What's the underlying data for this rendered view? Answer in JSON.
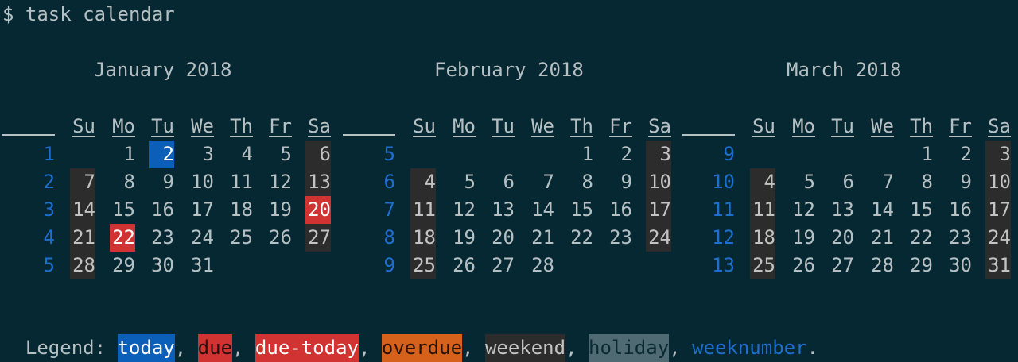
{
  "terminal": {
    "prompt": "$ task calendar"
  },
  "calendar": {
    "day_headers": [
      "Su",
      "Mo",
      "Tu",
      "We",
      "Th",
      "Fr",
      "Sa"
    ],
    "months": [
      {
        "title": "January 2018",
        "weeks": [
          {
            "num": "1",
            "days": [
              "",
              "1",
              "2",
              "3",
              "4",
              "5",
              "6"
            ]
          },
          {
            "num": "2",
            "days": [
              "7",
              "8",
              "9",
              "10",
              "11",
              "12",
              "13"
            ]
          },
          {
            "num": "3",
            "days": [
              "14",
              "15",
              "16",
              "17",
              "18",
              "19",
              "20"
            ]
          },
          {
            "num": "4",
            "days": [
              "21",
              "22",
              "23",
              "24",
              "25",
              "26",
              "27"
            ]
          },
          {
            "num": "5",
            "days": [
              "28",
              "29",
              "30",
              "31",
              "",
              "",
              ""
            ]
          }
        ],
        "today": "2",
        "due": [
          "22"
        ],
        "due_today_or_highlight": [
          "20"
        ]
      },
      {
        "title": "February 2018",
        "weeks": [
          {
            "num": "5",
            "days": [
              "",
              "",
              "",
              "",
              "1",
              "2",
              "3"
            ]
          },
          {
            "num": "6",
            "days": [
              "4",
              "5",
              "6",
              "7",
              "8",
              "9",
              "10"
            ]
          },
          {
            "num": "7",
            "days": [
              "11",
              "12",
              "13",
              "14",
              "15",
              "16",
              "17"
            ]
          },
          {
            "num": "8",
            "days": [
              "18",
              "19",
              "20",
              "21",
              "22",
              "23",
              "24"
            ]
          },
          {
            "num": "9",
            "days": [
              "25",
              "26",
              "27",
              "28",
              "",
              "",
              ""
            ]
          }
        ]
      },
      {
        "title": "March 2018",
        "weeks": [
          {
            "num": "9",
            "days": [
              "",
              "",
              "",
              "",
              "1",
              "2",
              "3"
            ]
          },
          {
            "num": "10",
            "days": [
              "4",
              "5",
              "6",
              "7",
              "8",
              "9",
              "10"
            ]
          },
          {
            "num": "11",
            "days": [
              "11",
              "12",
              "13",
              "14",
              "15",
              "16",
              "17"
            ]
          },
          {
            "num": "12",
            "days": [
              "18",
              "19",
              "20",
              "21",
              "22",
              "23",
              "24"
            ]
          },
          {
            "num": "13",
            "days": [
              "25",
              "26",
              "27",
              "28",
              "29",
              "30",
              "31"
            ]
          }
        ]
      }
    ]
  },
  "legend": {
    "label": "Legend: ",
    "items": [
      "today",
      "due",
      "due-today",
      "overdue",
      "weekend",
      "holiday",
      "weeknumber"
    ],
    "separator": ", ",
    "end": "."
  },
  "colors": {
    "background": "#062833",
    "text": "#b6c0c2",
    "today": "#0b5fb8",
    "due": "#d03332",
    "overdue": "#d5611a",
    "weekend": "#2c2c2c",
    "holiday": "#4f6a73",
    "weeknumber": "#1d6fcf"
  }
}
